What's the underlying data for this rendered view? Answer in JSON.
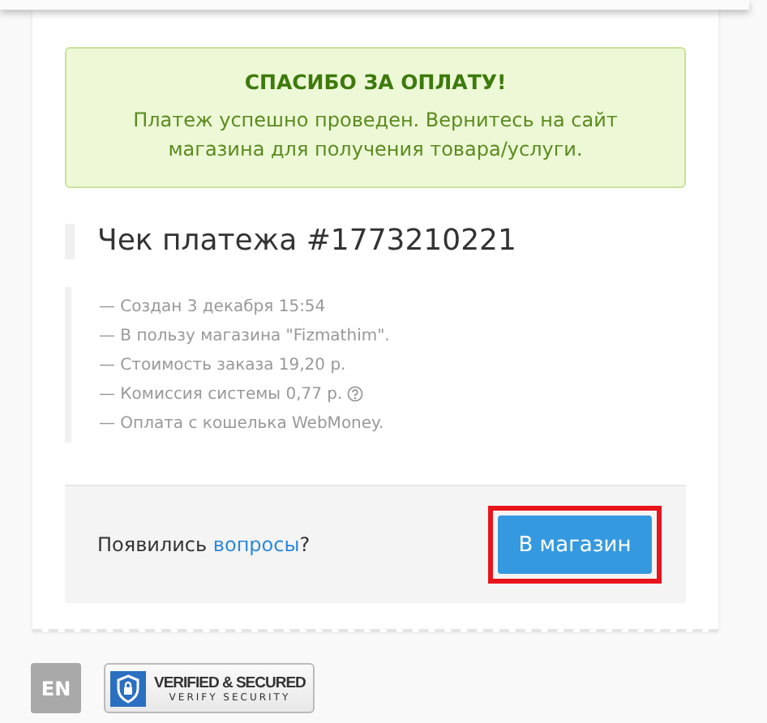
{
  "alert": {
    "title": "СПАСИБО ЗА ОПЛАТУ!",
    "message": "Платеж успешно проведен. Вернитесь на сайт магазина для получения товара/услуги."
  },
  "receipt": {
    "title": "Чек платежа #1773210221",
    "items": [
      {
        "text": "— Создан 3 декабря 15:54",
        "help": false
      },
      {
        "text": "— В пользу магазина \"Fizmathim\".",
        "help": false
      },
      {
        "text": "— Стоимость заказа 19,20 р.",
        "help": false
      },
      {
        "text": "— Комиссия системы 0,77 р.",
        "help": true
      },
      {
        "text": "— Оплата с кошелька WebMoney.",
        "help": false
      }
    ]
  },
  "footer": {
    "question": "Появились ",
    "link": "вопросы",
    "question_end": "?",
    "button": {
      "label": "В магазин",
      "highlighted": true
    }
  },
  "language": "EN",
  "badge": {
    "title": "VERIFIED & SECURED",
    "subtitle": "VERIFY SECURITY"
  }
}
